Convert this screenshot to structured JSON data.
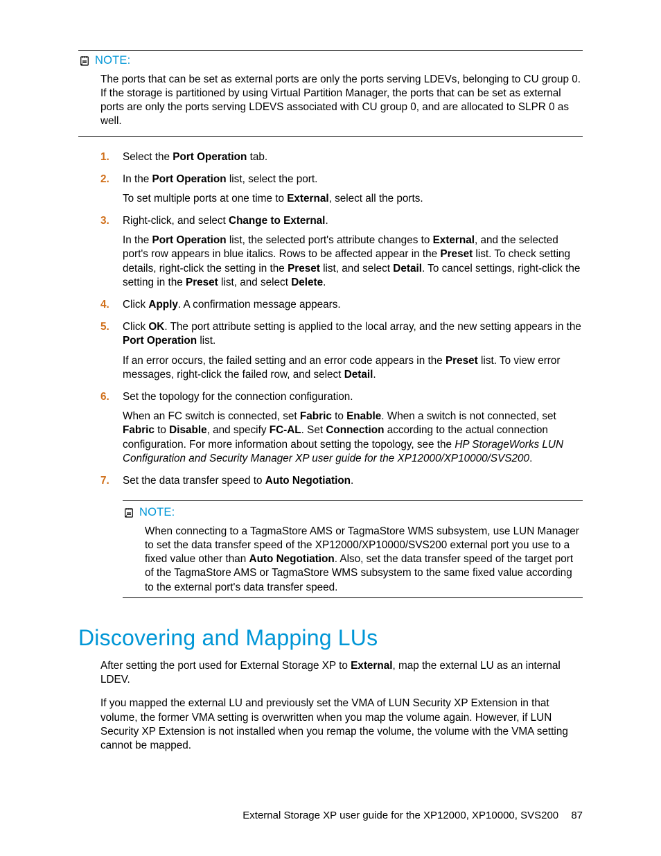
{
  "note1": {
    "label": "NOTE:",
    "body": "The ports that can be set as external ports are only the ports serving LDEVs, belonging to CU group 0. If the storage is partitioned by using Virtual Partition Manager, the ports that can be set as external ports are only the ports serving LDEVS associated with CU group 0, and are allocated to SLPR 0 as well."
  },
  "steps": [
    {
      "num": "1.",
      "paras": [
        {
          "segments": [
            {
              "t": "Select the "
            },
            {
              "t": "Port Operation",
              "b": true
            },
            {
              "t": " tab."
            }
          ]
        }
      ]
    },
    {
      "num": "2.",
      "paras": [
        {
          "segments": [
            {
              "t": "In the "
            },
            {
              "t": "Port Operation",
              "b": true
            },
            {
              "t": " list, select the port."
            }
          ]
        },
        {
          "segments": [
            {
              "t": "To set multiple ports at one time to "
            },
            {
              "t": "External",
              "b": true
            },
            {
              "t": ", select all the ports."
            }
          ]
        }
      ]
    },
    {
      "num": "3.",
      "paras": [
        {
          "segments": [
            {
              "t": "Right-click, and select "
            },
            {
              "t": "Change to External",
              "b": true
            },
            {
              "t": "."
            }
          ]
        },
        {
          "segments": [
            {
              "t": "In the "
            },
            {
              "t": "Port Operation",
              "b": true
            },
            {
              "t": " list, the selected port's attribute changes to "
            },
            {
              "t": "External",
              "b": true
            },
            {
              "t": ", and the selected port's row appears in blue italics. Rows to be affected appear in the "
            },
            {
              "t": "Preset",
              "b": true
            },
            {
              "t": " list. To check setting details, right-click the setting in the "
            },
            {
              "t": "Preset",
              "b": true
            },
            {
              "t": " list, and select "
            },
            {
              "t": "Detail",
              "b": true
            },
            {
              "t": ". To cancel settings, right-click the setting in the "
            },
            {
              "t": "Preset",
              "b": true
            },
            {
              "t": " list, and select "
            },
            {
              "t": "Delete",
              "b": true
            },
            {
              "t": "."
            }
          ]
        }
      ]
    },
    {
      "num": "4.",
      "paras": [
        {
          "segments": [
            {
              "t": "Click "
            },
            {
              "t": "Apply",
              "b": true
            },
            {
              "t": ". A confirmation message appears."
            }
          ]
        }
      ]
    },
    {
      "num": "5.",
      "paras": [
        {
          "segments": [
            {
              "t": "Click "
            },
            {
              "t": "OK",
              "b": true
            },
            {
              "t": ". The port attribute setting is applied to the local array, and the new setting appears in the "
            },
            {
              "t": "Port Operation",
              "b": true
            },
            {
              "t": " list."
            }
          ]
        },
        {
          "segments": [
            {
              "t": "If an error occurs, the failed setting and an error code appears in the "
            },
            {
              "t": "Preset",
              "b": true
            },
            {
              "t": " list. To view error messages, right-click the failed row, and select "
            },
            {
              "t": "Detail",
              "b": true
            },
            {
              "t": "."
            }
          ]
        }
      ]
    },
    {
      "num": "6.",
      "paras": [
        {
          "segments": [
            {
              "t": "Set the topology for the connection configuration."
            }
          ]
        },
        {
          "segments": [
            {
              "t": "When an FC switch is connected, set "
            },
            {
              "t": "Fabric",
              "b": true
            },
            {
              "t": " to "
            },
            {
              "t": "Enable",
              "b": true
            },
            {
              "t": ". When a switch is not connected, set "
            },
            {
              "t": "Fabric",
              "b": true
            },
            {
              "t": " to "
            },
            {
              "t": "Disable",
              "b": true
            },
            {
              "t": ", and specify "
            },
            {
              "t": "FC-AL",
              "b": true
            },
            {
              "t": ". Set "
            },
            {
              "t": "Connection",
              "b": true
            },
            {
              "t": " according to the actual connection configuration. For more information about setting the topology, see the "
            },
            {
              "t": "HP StorageWorks LUN Configuration and Security Manager XP user guide for the XP12000/XP10000/SVS200",
              "i": true
            },
            {
              "t": "."
            }
          ]
        }
      ]
    },
    {
      "num": "7.",
      "paras": [
        {
          "segments": [
            {
              "t": "Set the data transfer speed to "
            },
            {
              "t": "Auto Negotiation",
              "b": true
            },
            {
              "t": "."
            }
          ]
        }
      ]
    }
  ],
  "note2": {
    "label": "NOTE:",
    "segments": [
      {
        "t": "When connecting to a TagmaStore AMS or TagmaStore WMS subsystem, use LUN Manager to set the data transfer speed of the XP12000/XP10000/SVS200 external port you use to a fixed value other than "
      },
      {
        "t": "Auto Negotiation",
        "b": true
      },
      {
        "t": ". Also, set the data transfer speed of the target port of the TagmaStore AMS or TagmaStore WMS subsystem to the same fixed value according to the external port's data transfer speed."
      }
    ]
  },
  "section": {
    "title": "Discovering and Mapping LUs",
    "paras": [
      {
        "segments": [
          {
            "t": "After setting the port used for External Storage XP to "
          },
          {
            "t": "External",
            "b": true
          },
          {
            "t": ", map the external LU as an internal LDEV."
          }
        ]
      },
      {
        "segments": [
          {
            "t": "If you mapped the external LU and previously set the VMA of LUN Security XP Extension in that volume, the former VMA setting is overwritten when you map the volume again. However, if LUN Security XP Extension is not installed when you remap the volume, the volume with the VMA setting cannot be mapped."
          }
        ]
      }
    ]
  },
  "footer": {
    "text": "External Storage XP user guide for the XP12000, XP10000, SVS200",
    "page": "87"
  }
}
